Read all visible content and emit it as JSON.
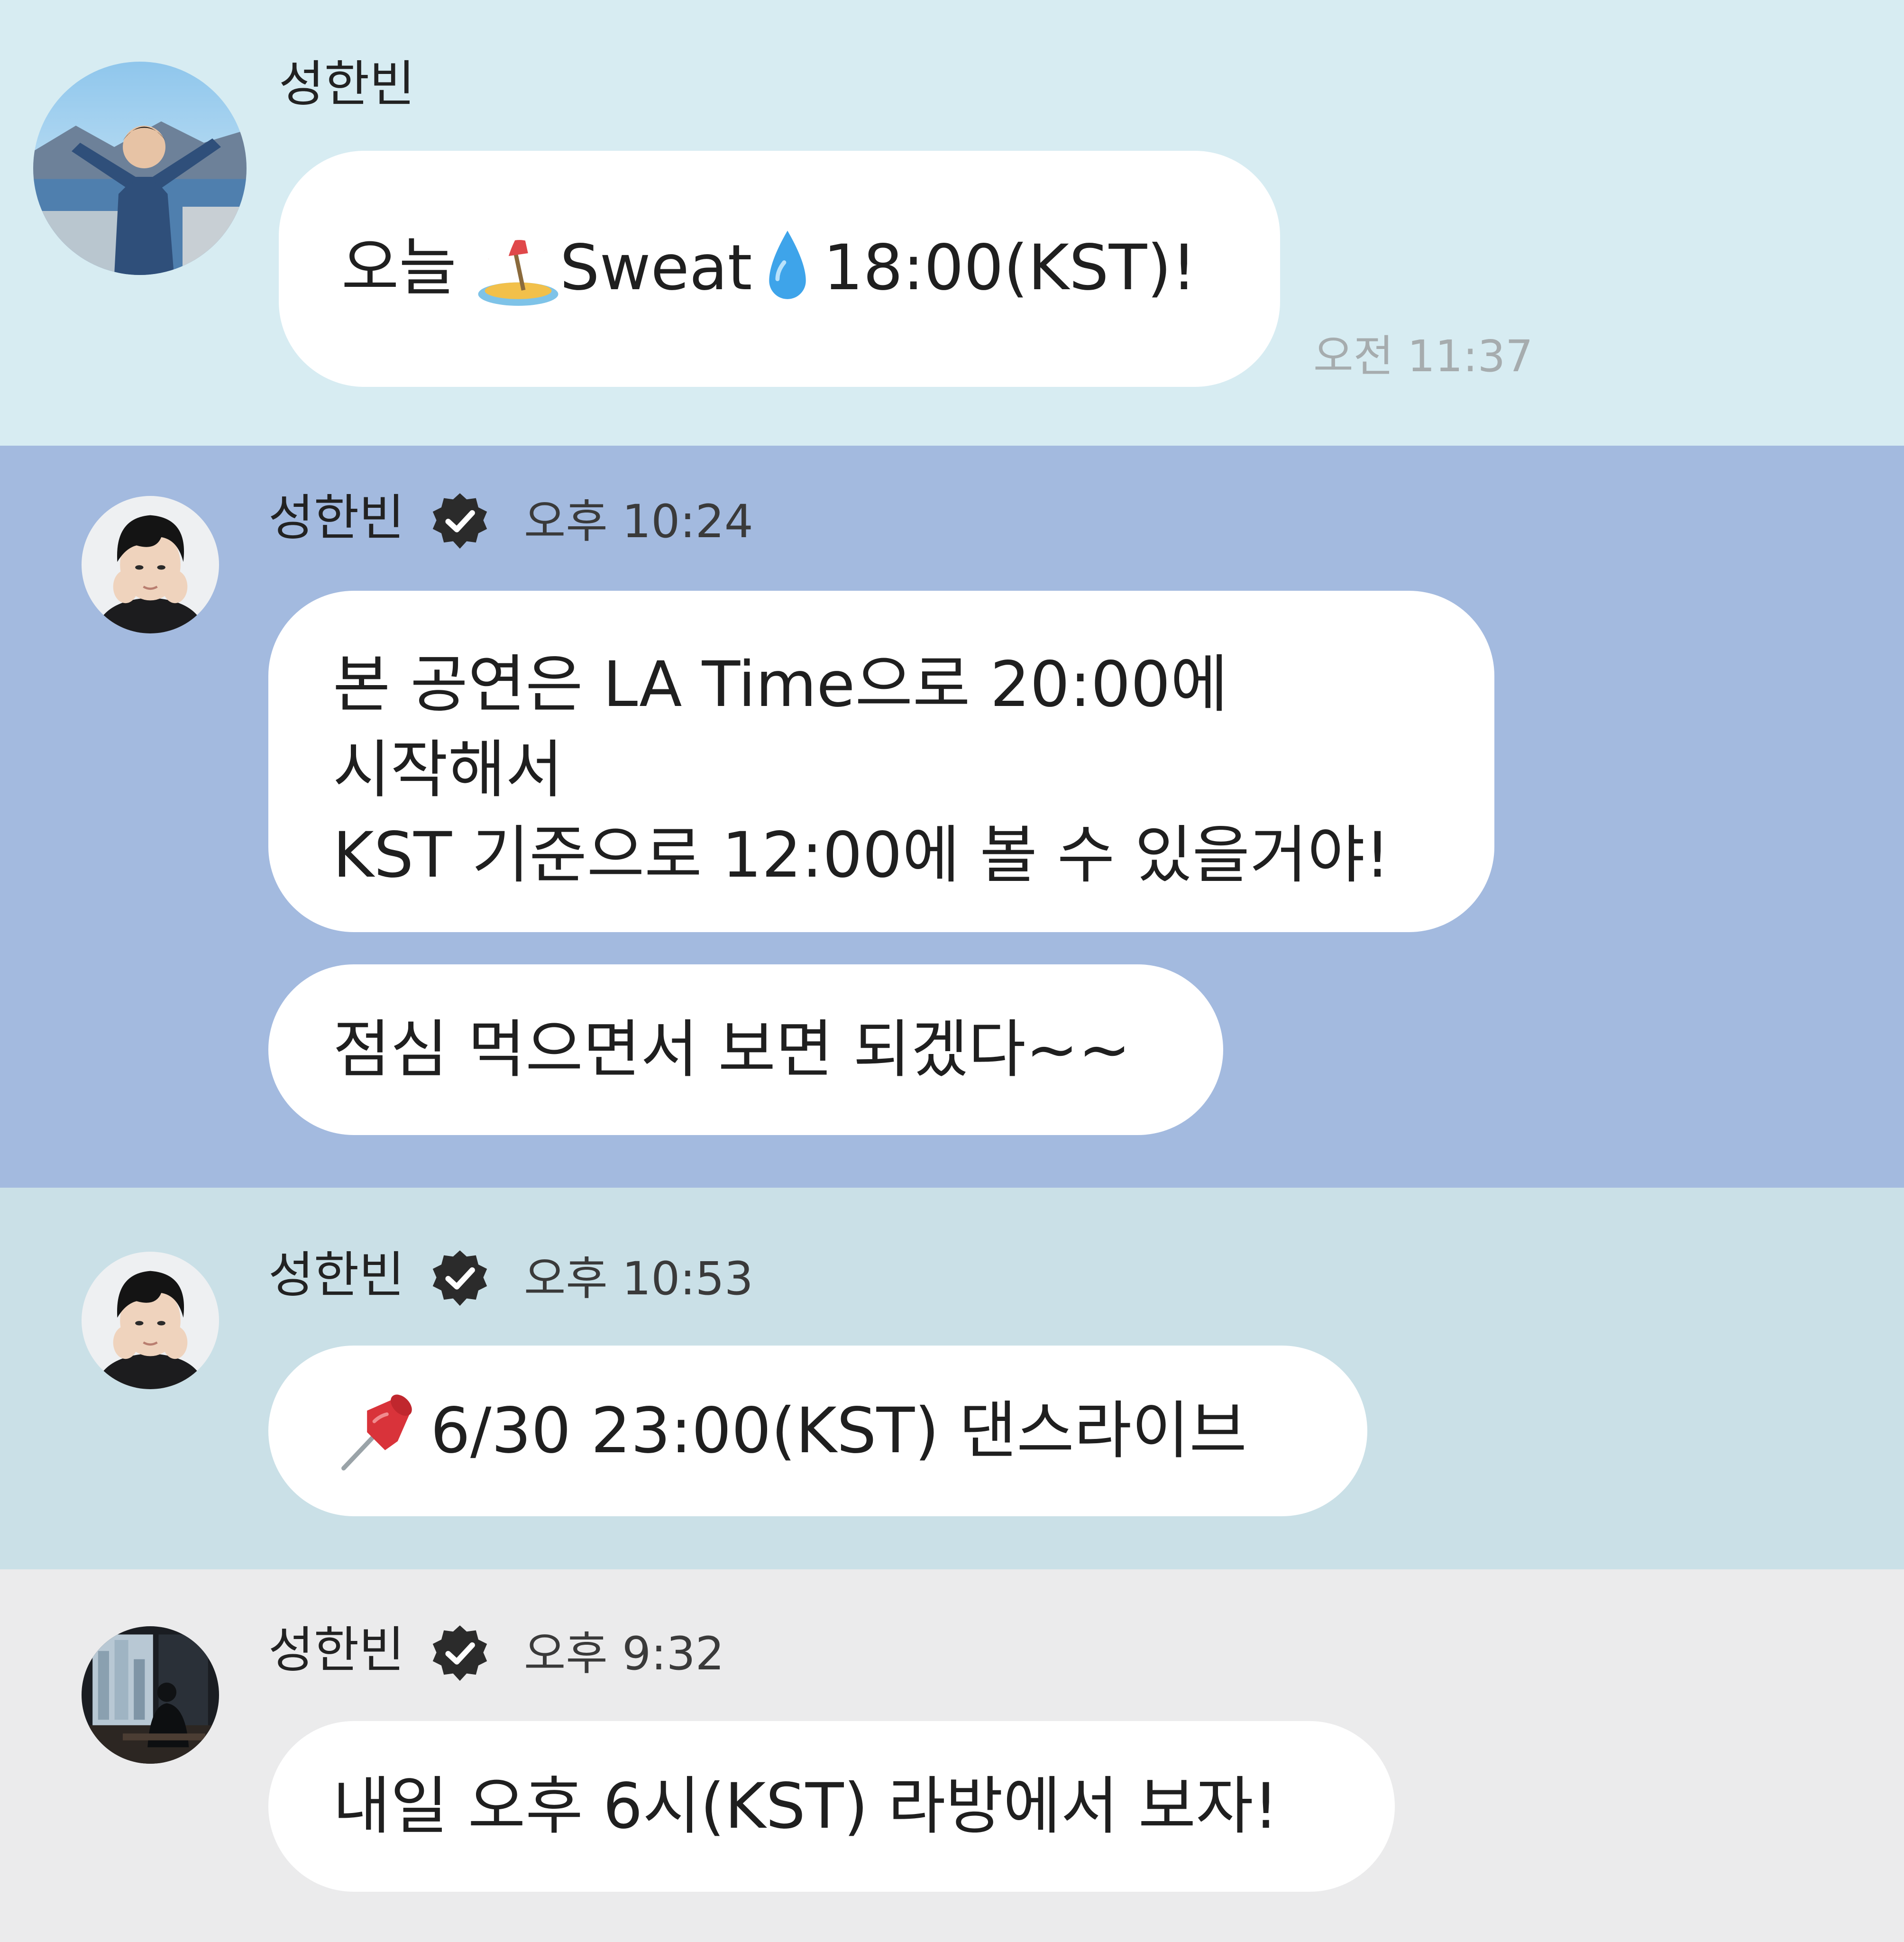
{
  "messages": [
    {
      "sender": "성한빈",
      "verified": false,
      "time": "오전 11:37",
      "avatar_icon": "profile-photo-waterfront",
      "bubbles": [
        {
          "prefix": "오늘 ",
          "emoji1": "beach-umbrella-icon",
          "mid": "Sweat",
          "emoji2": "droplet-icon",
          "suffix": "18:00(KST)!"
        }
      ]
    },
    {
      "sender": "성한빈",
      "verified": true,
      "time": "오후 10:24",
      "avatar_icon": "profile-photo-face",
      "bubbles": [
        {
          "lines": [
            "본 공연은 LA Time으로 20:00에",
            "시작해서",
            "KST 기준으로 12:00에 볼 수 있을거야!"
          ]
        },
        {
          "text": "점심 먹으면서 보면 되겠다~~"
        }
      ]
    },
    {
      "sender": "성한빈",
      "verified": true,
      "time": "오후 10:53",
      "avatar_icon": "profile-photo-face",
      "bubbles": [
        {
          "emoji": "pushpin-icon",
          "text": "6/30 23:00(KST) 댄스라이브"
        }
      ]
    },
    {
      "sender": "성한빈",
      "verified": true,
      "time": "오후 9:32",
      "avatar_icon": "profile-photo-window",
      "bubbles": [
        {
          "text": "내일 오후 6시(KST) 라방에서 보자!"
        }
      ]
    }
  ],
  "colors": {
    "section_1": "#d7ecf2",
    "section_2": "#a3badf",
    "section_3": "#cae0e7",
    "section_4": "#ebebec",
    "bubble": "#ffffff",
    "verified_badge": "#2b2b2b"
  }
}
